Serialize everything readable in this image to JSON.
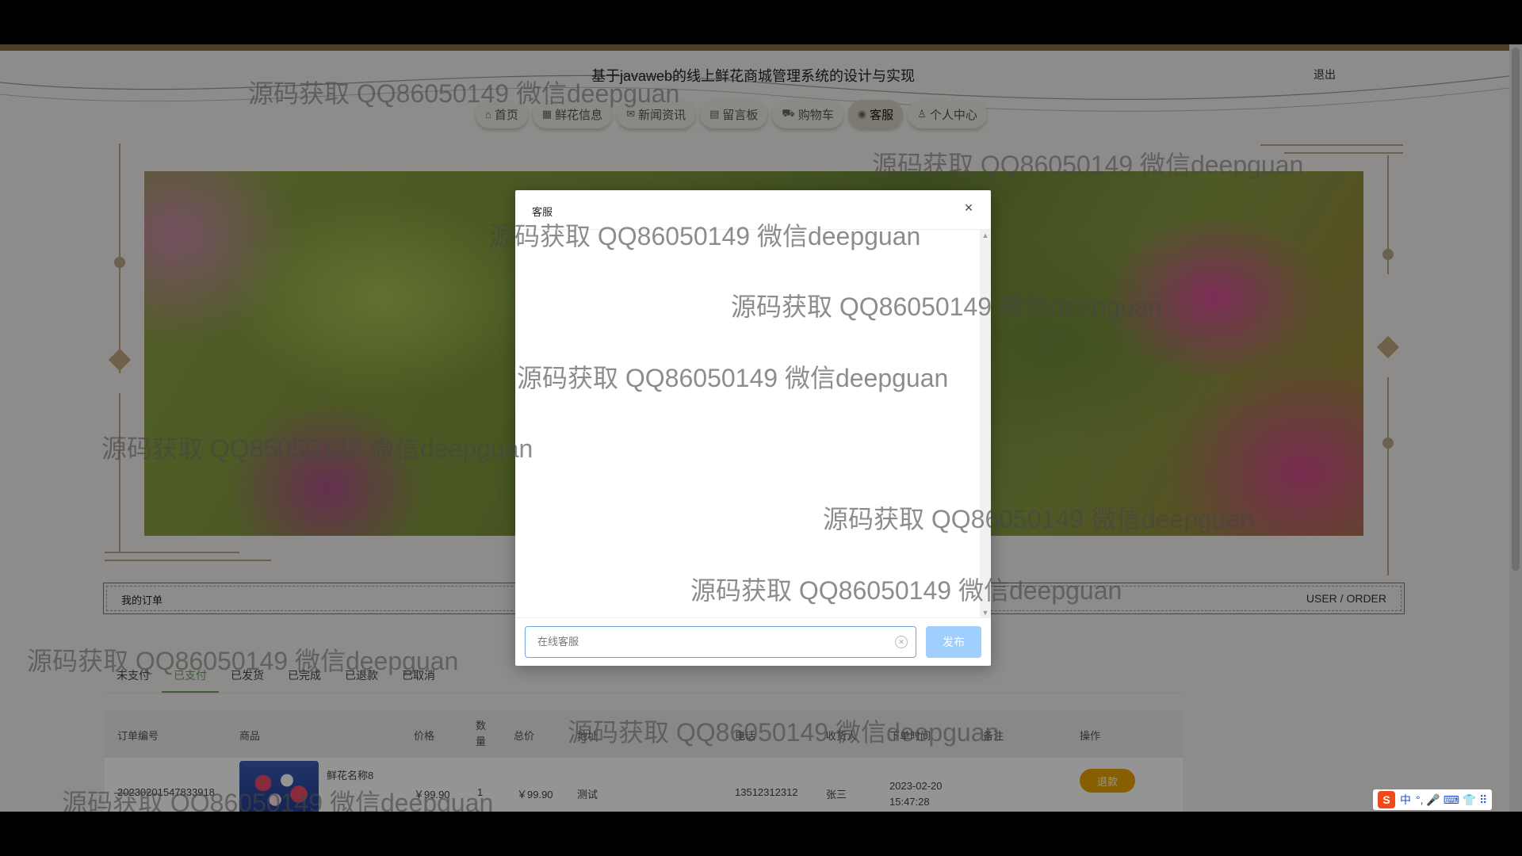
{
  "site": {
    "title": "基于javaweb的线上鲜花商城管理系统的设计与实现",
    "logout": "退出"
  },
  "nav": [
    {
      "icon": "home-icon",
      "glyph": "⌂",
      "label": "首页"
    },
    {
      "icon": "flower-icon",
      "glyph": "▦",
      "label": "鲜花信息"
    },
    {
      "icon": "mail-icon",
      "glyph": "✉",
      "label": "新闻资讯"
    },
    {
      "icon": "board-icon",
      "glyph": "▤",
      "label": "留言板"
    },
    {
      "icon": "cart-icon",
      "glyph": "⛟",
      "label": "购物车"
    },
    {
      "icon": "service-icon",
      "glyph": "◉",
      "label": "客服",
      "active": true
    },
    {
      "icon": "user-icon",
      "glyph": "♙",
      "label": "个人中心"
    }
  ],
  "strip": {
    "left": "我的订单",
    "right": "USER / ORDER"
  },
  "tabs": [
    "未支付",
    "已支付",
    "已发货",
    "已完成",
    "已退款",
    "已取消"
  ],
  "active_tab": "已支付",
  "table": {
    "headers": [
      "订单编号",
      "商品",
      "价格",
      "数量",
      "总价",
      "地址",
      "电话",
      "收货人",
      "下单时间",
      "备注",
      "操作"
    ],
    "rows": [
      {
        "order_no": "20230201547833918",
        "product": "鲜花名称8",
        "price": "￥99.90",
        "qty": "1",
        "total": "￥99.90",
        "address": "测试",
        "phone": "13512312312",
        "receiver": "张三",
        "date": "2023-02-20",
        "time": "15:47:28",
        "action": "退款"
      }
    ]
  },
  "dialog": {
    "title": "客服",
    "close": "×",
    "input_placeholder": "在线客服",
    "submit": "发布"
  },
  "watermark": "源码获取 QQ86050149 微信deepguan",
  "ime": {
    "logo": "S",
    "lang": "中",
    "items": "°, 🎤 ⌨ 👕 ⠿"
  }
}
